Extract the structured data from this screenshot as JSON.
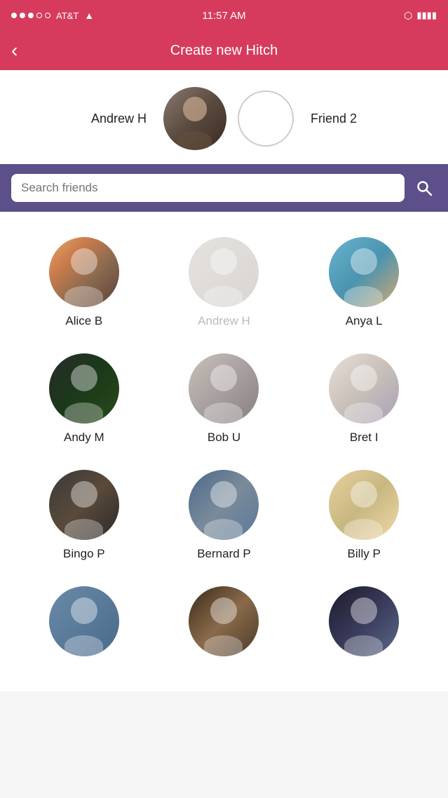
{
  "statusBar": {
    "carrier": "AT&T",
    "time": "11:57 AM",
    "bluetooth": "⬡",
    "battery": "▮▮▮▮"
  },
  "navBar": {
    "title": "Create new Hitch",
    "backLabel": "‹"
  },
  "userSelection": {
    "user1": {
      "name": "Andrew H",
      "hasAvatar": true
    },
    "user2": {
      "name": "Friend 2",
      "hasAvatar": false
    }
  },
  "search": {
    "placeholder": "Search friends"
  },
  "friends": [
    {
      "name": "Alice B",
      "avatarClass": "avatar-alice",
      "dimmed": false
    },
    {
      "name": "Andrew H",
      "avatarClass": "avatar-andrew-h",
      "dimmed": true
    },
    {
      "name": "Anya L",
      "avatarClass": "avatar-anya",
      "dimmed": false
    },
    {
      "name": "Andy M",
      "avatarClass": "avatar-andy",
      "dimmed": false
    },
    {
      "name": "Bob U",
      "avatarClass": "avatar-bob",
      "dimmed": false
    },
    {
      "name": "Bret I",
      "avatarClass": "avatar-bret",
      "dimmed": false
    },
    {
      "name": "Bingo P",
      "avatarClass": "avatar-bingo",
      "dimmed": false
    },
    {
      "name": "Bernard P",
      "avatarClass": "avatar-bernard",
      "dimmed": false
    },
    {
      "name": "Billy P",
      "avatarClass": "avatar-billy",
      "dimmed": false
    },
    {
      "name": "",
      "avatarClass": "avatar-row4-1",
      "dimmed": false
    },
    {
      "name": "",
      "avatarClass": "avatar-row4-2",
      "dimmed": false
    },
    {
      "name": "",
      "avatarClass": "avatar-row4-3",
      "dimmed": false
    }
  ]
}
